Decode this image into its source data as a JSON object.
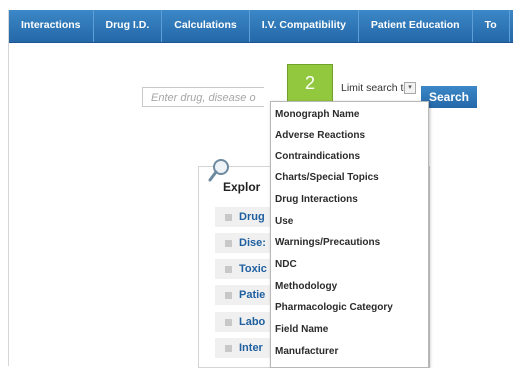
{
  "nav": {
    "tabs": [
      "Interactions",
      "Drug I.D.",
      "Calculations",
      "I.V. Compatibility",
      "Patient Education",
      "To"
    ]
  },
  "search": {
    "placeholder": "Enter drug, disease o",
    "button": "Search",
    "limit_label": "Limit search to",
    "limit_arrow": "▾"
  },
  "step_badge": "2",
  "explore": {
    "title": "Explor",
    "items": [
      "Drug",
      "Dise:",
      "Toxic",
      "Patie",
      "Labo",
      "Inter"
    ]
  },
  "dropdown": {
    "options": [
      "Monograph Name",
      "Adverse Reactions",
      "Contraindications",
      "Charts/Special Topics",
      "Drug Interactions",
      "Use",
      "Warnings/Precautions",
      "NDC",
      "Methodology",
      "Pharmacologic Category",
      "Field Name",
      "Manufacturer"
    ]
  }
}
